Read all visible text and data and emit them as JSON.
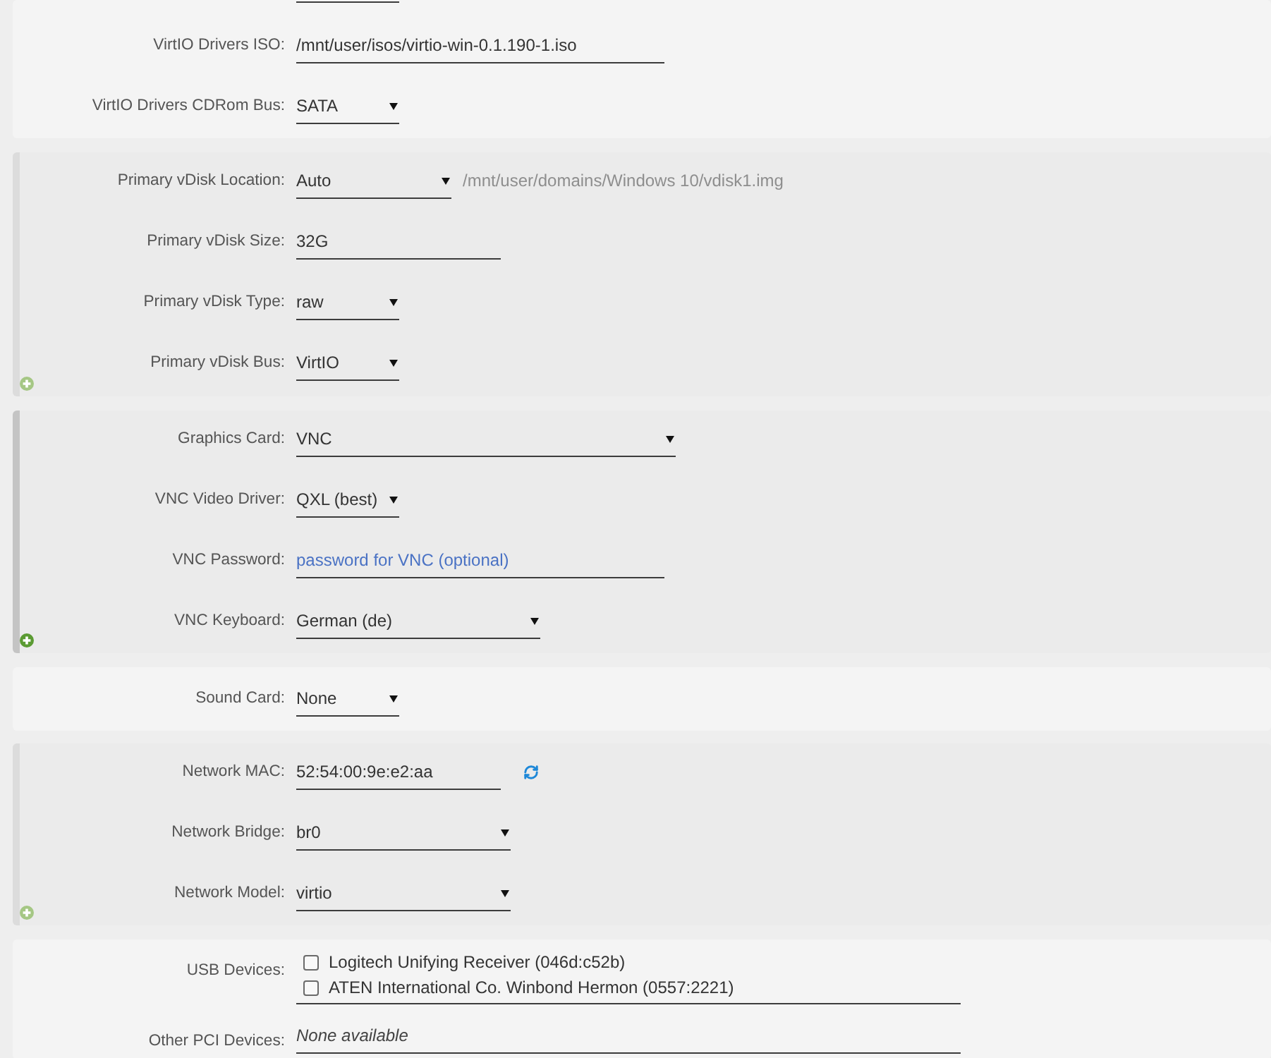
{
  "sections": [
    {
      "kind": "plain",
      "rows": [
        {
          "label": "VirtIO Drivers ISO:",
          "kind": "input",
          "value": "/mnt/user/isos/virtio-win-0.1.190-1.iso"
        },
        {
          "label": "VirtIO Drivers CDRom Bus:",
          "kind": "select",
          "value": "SATA"
        }
      ]
    },
    {
      "kind": "group",
      "highlighted": false,
      "rows": [
        {
          "label": "Primary vDisk Location:",
          "kind": "select",
          "value": "Auto",
          "path": {
            "value": "/mnt/user/domains/Windows 10/vdisk1.img",
            "disabled": true
          }
        },
        {
          "label": "Primary vDisk Size:",
          "kind": "input",
          "value": "32G"
        },
        {
          "label": "Primary vDisk Type:",
          "kind": "select",
          "value": "raw"
        },
        {
          "label": "Primary vDisk Bus:",
          "kind": "select",
          "value": "VirtIO"
        }
      ]
    },
    {
      "kind": "group",
      "highlighted": true,
      "rows": [
        {
          "label": "Graphics Card:",
          "kind": "select",
          "value": "VNC"
        },
        {
          "label": "VNC Video Driver:",
          "kind": "select",
          "value": "QXL (best)"
        },
        {
          "label": "VNC Password:",
          "kind": "input",
          "placeholder": "password for VNC (optional)"
        },
        {
          "label": "VNC Keyboard:",
          "kind": "select",
          "value": "German (de)"
        }
      ]
    },
    {
      "kind": "plain",
      "rows": [
        {
          "label": "Sound Card:",
          "kind": "select",
          "value": "None"
        }
      ]
    },
    {
      "kind": "group",
      "highlighted": false,
      "rows": [
        {
          "label": "Network MAC:",
          "kind": "mac",
          "value": "52:54:00:9e:e2:aa"
        },
        {
          "label": "Network Bridge:",
          "kind": "select",
          "value": "br0"
        },
        {
          "label": "Network Model:",
          "kind": "select",
          "value": "virtio"
        }
      ]
    },
    {
      "kind": "plain",
      "rows": [
        {
          "label": "USB Devices:",
          "kind": "checklist",
          "options": [
            {
              "label": "Logitech Unifying Receiver (046d:c52b)",
              "checked": false
            },
            {
              "label": "ATEN International Co. Winbond Hermon (0557:2221)",
              "checked": false
            }
          ]
        },
        {
          "label": "Other PCI Devices:",
          "kind": "note",
          "value": "None available"
        }
      ]
    }
  ]
}
